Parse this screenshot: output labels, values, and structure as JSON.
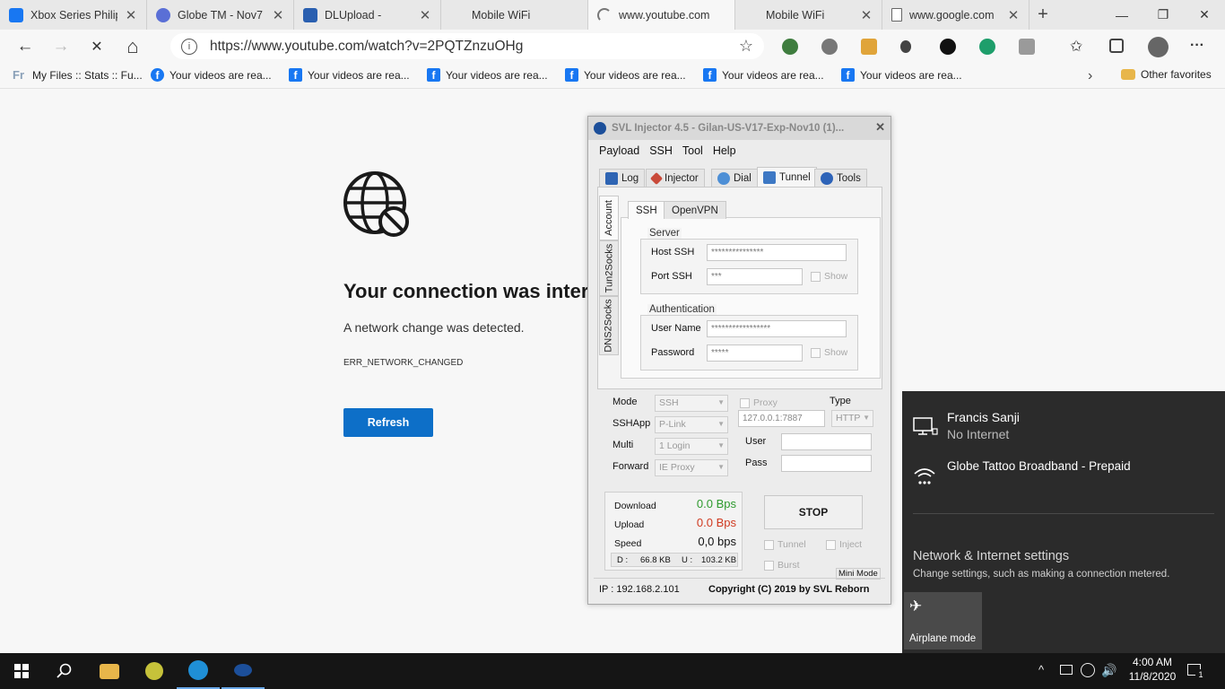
{
  "browser": {
    "tabs": [
      {
        "title": "Xbox Series Philippines",
        "icon": "facebook-icon",
        "color": "#1877f2",
        "active": false
      },
      {
        "title": "Globe TM - Nov7",
        "icon": "globe-tm-icon",
        "color": "#5a6fd6",
        "active": false
      },
      {
        "title": "DLUpload -",
        "icon": "dlupload-icon",
        "color": "#2a5fb0",
        "active": false
      },
      {
        "title": "Mobile WiFi",
        "icon": "blank-icon",
        "color": "#dddddd",
        "active": false
      },
      {
        "title": "www.youtube.com",
        "icon": "loading-spinner-icon",
        "color": "#666666",
        "active": true
      },
      {
        "title": "Mobile WiFi",
        "icon": "blank-icon",
        "color": "#dddddd",
        "active": false
      },
      {
        "title": "www.google.com",
        "icon": "page-icon",
        "color": "#ffffff",
        "active": false
      }
    ],
    "close_glyph": "✕",
    "new_tab_glyph": "+",
    "address": {
      "url": "https://www.youtube.com/watch?v=2PQTZnzuOHg",
      "info_glyph": "i",
      "star_glyph": "☆"
    },
    "nav": {
      "back": "←",
      "forward": "→",
      "stop": "✕",
      "home": "⌂"
    },
    "window_controls": {
      "minimize": "—",
      "maximize": "❐",
      "close": "✕"
    },
    "favorites": [
      {
        "label": "My Files :: Stats :: Fu...",
        "icon": "fr-icon"
      },
      {
        "label": "Your videos are rea...",
        "icon": "facebook-icon"
      },
      {
        "label": "Your videos are rea...",
        "icon": "facebook-icon"
      },
      {
        "label": "Your videos are rea...",
        "icon": "facebook-icon"
      },
      {
        "label": "Your videos are rea...",
        "icon": "facebook-icon"
      },
      {
        "label": "Your videos are rea...",
        "icon": "facebook-icon"
      },
      {
        "label": "Your videos are rea...",
        "icon": "facebook-icon"
      }
    ],
    "other_favorites": "Other favorites",
    "menu_glyph": "···"
  },
  "error_page": {
    "title": "Your connection was interrupted",
    "description": "A network change was detected.",
    "code": "ERR_NETWORK_CHANGED",
    "button": "Refresh"
  },
  "svl": {
    "title": "SVL Injector 4.5 - Gilan-US-V17-Exp-Nov10 (1)...",
    "close_glyph": "✕",
    "menu": [
      "Payload",
      "SSH",
      "Tool",
      "Help"
    ],
    "tabs": [
      "Log",
      "Injector",
      "Dial",
      "Tunnel",
      "Tools"
    ],
    "active_tab": "Tunnel",
    "side_tabs": [
      "Account",
      "Tun2Socks",
      "DNS2Socks"
    ],
    "sub_tabs": [
      "SSH",
      "OpenVPN"
    ],
    "server": {
      "group": "Server",
      "host_label": "Host SSH",
      "host_value": "***************",
      "port_label": "Port SSH",
      "port_value": "***",
      "show_label": "Show"
    },
    "auth": {
      "group": "Authentication",
      "user_label": "User Name",
      "user_value": "*****************",
      "pass_label": "Password",
      "pass_value": "*****",
      "show_label": "Show"
    },
    "options": {
      "mode_label": "Mode",
      "mode_value": "SSH",
      "sshapp_label": "SSHApp",
      "sshapp_value": "P-Link",
      "multi_label": "Multi",
      "multi_value": "1 Login",
      "forward_label": "Forward",
      "forward_value": "IE Proxy",
      "proxy_label": "Proxy",
      "proxy_value": "127.0.0.1:7887",
      "type_label": "Type",
      "type_value": "HTTP",
      "user_label": "User",
      "pass_label": "Pass"
    },
    "stats": {
      "download_label": "Download",
      "download_value": "0.0 Bps",
      "upload_label": "Upload",
      "upload_value": "0.0 Bps",
      "speed_label": "Speed",
      "speed_value": "0,0 bps",
      "d_label": "D :",
      "d_value": "66.8 KB",
      "u_label": "U :",
      "u_value": "103.2 KB",
      "download_color": "#2e9a2e",
      "upload_color": "#d0391f"
    },
    "stop_button": "STOP",
    "checks": {
      "tunnel": "Tunnel",
      "inject": "Inject",
      "burst": "Burst"
    },
    "mini_mode": "Mini Mode",
    "ip": "IP : 192.168.2.101",
    "copyright": "Copyright (C) 2019 by SVL Reborn"
  },
  "network_flyout": {
    "networks": [
      {
        "name": "Francis Sanji",
        "status": "No Internet",
        "icon": "ethernet-monitor-icon"
      },
      {
        "name": "Globe Tattoo Broadband - Prepaid",
        "status": "",
        "icon": "dialup-icon"
      }
    ],
    "settings_title": "Network & Internet settings",
    "settings_desc": "Change settings, such as making a connection metered.",
    "airplane_label": "Airplane mode"
  },
  "taskbar": {
    "time": "4:00 AM",
    "date": "11/8/2020",
    "notification_count": "1",
    "tray_chevron": "^"
  }
}
